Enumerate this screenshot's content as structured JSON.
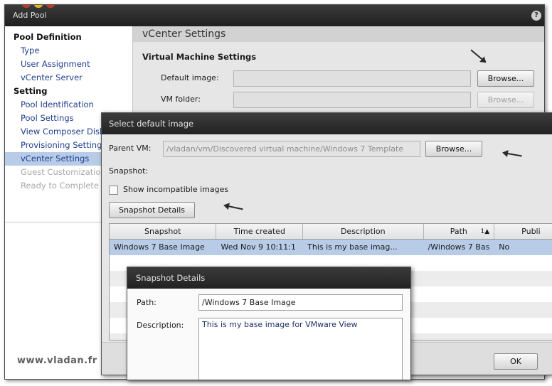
{
  "main_window": {
    "title": "Add Pool",
    "help_label": "?",
    "nav": [
      {
        "label": "Pool Definition",
        "kind": "header",
        "state": "normal"
      },
      {
        "label": "Type",
        "kind": "item",
        "state": "normal"
      },
      {
        "label": "User Assignment",
        "kind": "item",
        "state": "normal"
      },
      {
        "label": "vCenter Server",
        "kind": "item",
        "state": "normal"
      },
      {
        "label": "Setting",
        "kind": "header",
        "state": "normal"
      },
      {
        "label": "Pool Identification",
        "kind": "item",
        "state": "normal"
      },
      {
        "label": "Pool Settings",
        "kind": "item",
        "state": "normal"
      },
      {
        "label": "View Composer Disks",
        "kind": "item",
        "state": "normal"
      },
      {
        "label": "Provisioning Settings",
        "kind": "item",
        "state": "normal"
      },
      {
        "label": "vCenter Settings",
        "kind": "item",
        "state": "selected"
      },
      {
        "label": "Guest Customization",
        "kind": "item",
        "state": "disabled"
      },
      {
        "label": "Ready to Complete",
        "kind": "item",
        "state": "disabled"
      }
    ],
    "content_title": "vCenter Settings",
    "section_label": "Virtual Machine Settings",
    "default_image_label": "Default image:",
    "vm_folder_label": "VM folder:",
    "browse_label": "Browse...",
    "watermark": "www.vladan.fr"
  },
  "select_image_dialog": {
    "title": "Select default image",
    "parent_vm_label": "Parent VM:",
    "parent_vm_value": "/vladan/vm/Discovered virtual machine/Windows 7 Template",
    "browse_label": "Browse...",
    "snapshot_label": "Snapshot:",
    "show_incompatible_label": "Show incompatible images",
    "show_incompatible_checked": false,
    "snapshot_details_button": "Snapshot Details",
    "table": {
      "columns": [
        "Snapshot",
        "Time created",
        "Description",
        "Path",
        "Publi"
      ],
      "sort_indicator": "1▲",
      "rows": [
        [
          "Windows 7 Base Image",
          "Wed Nov 9 10:11:1",
          "This is my base imag...",
          "/Windows 7 Bas",
          "No"
        ]
      ]
    },
    "ok_label": "OK"
  },
  "snapshot_details": {
    "title": "Snapshot Details",
    "path_label": "Path:",
    "path_value": "/Windows 7 Base Image",
    "description_label": "Description:",
    "description_value": "This is my base image for VMware View"
  },
  "colors": {
    "title_bar": "#2a2a2a",
    "selection": "#b8cce8",
    "nav_link": "#1f3f8f"
  }
}
